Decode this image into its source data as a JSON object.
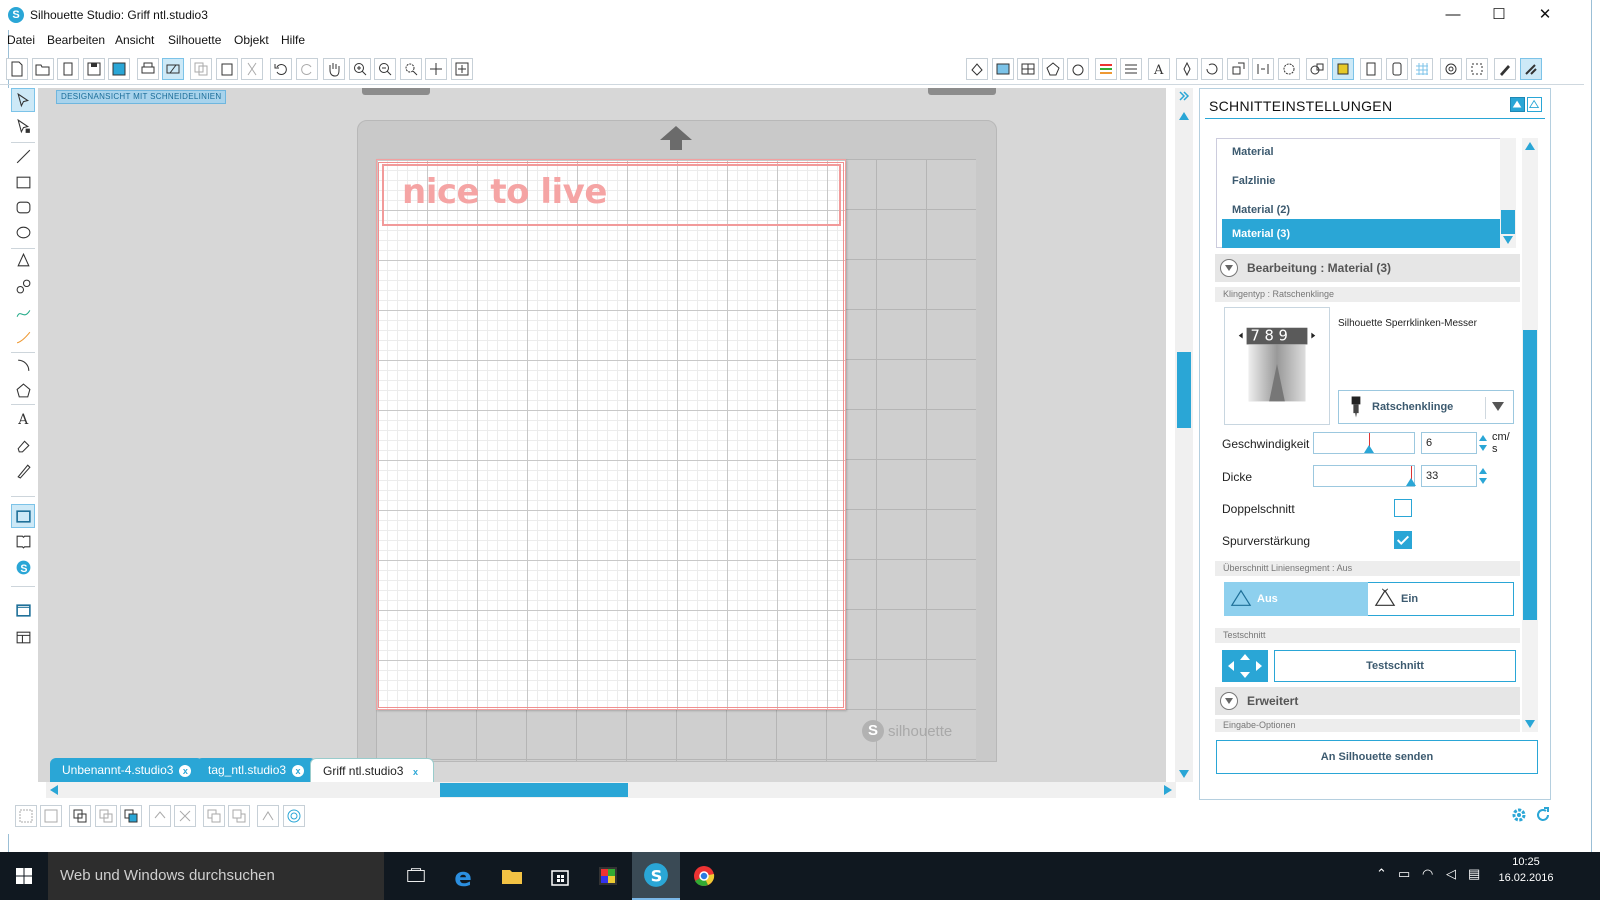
{
  "window": {
    "title": "Silhouette Studio: Griff ntl.studio3",
    "minimize": "—",
    "maximize": "☐",
    "close": "✕"
  },
  "menu": [
    "Datei",
    "Bearbeiten",
    "Ansicht",
    "Silhouette",
    "Objekt",
    "Hilfe"
  ],
  "canvas": {
    "view_label": "DESIGNANSICHT MIT SCHNEIDELINIEN",
    "design_text": "nice to live",
    "mat_brand": "silhouette"
  },
  "tabs": [
    {
      "label": "Unbenannt-4.studio3",
      "close": "x"
    },
    {
      "label": "tag_ntl.studio3",
      "close": "x"
    },
    {
      "label": "Griff ntl.studio3",
      "close": "x"
    }
  ],
  "panel": {
    "title": "SCHNITTEINSTELLUNGEN",
    "materials": [
      "Material",
      "Falzlinie",
      "Material (2)",
      "Material (3)"
    ],
    "list_add": "+",
    "list_remove": "—",
    "edit_section": "Bearbeitung : Material (3)",
    "blade_type_label": "Klingentyp : Ratschenklinge",
    "blade_name": "Silhouette Sperrklinken-Messer",
    "blade_dial": "7 8 9",
    "blade_select": "Ratschenklinge",
    "speed": {
      "label": "Geschwindigkeit",
      "value": "6",
      "unit": "cm/\ns",
      "level": 0.55
    },
    "thickness": {
      "label": "Dicke",
      "value": "33",
      "level": 0.97
    },
    "double_cut": {
      "label": "Doppelschnitt",
      "checked": false
    },
    "track_enhance": {
      "label": "Spurverstärkung",
      "checked": true
    },
    "overcut_label": "Überschnitt Liniensegment : Aus",
    "overcut_off": "Aus",
    "overcut_on": "Ein",
    "test_label": "Testschnitt",
    "test_button": "Testschnitt",
    "advanced": "Erweitert",
    "input_options": "Eingabe-Optionen",
    "send_button": "An Silhouette senden"
  },
  "taskbar": {
    "search_placeholder": "Web und Windows durchsuchen",
    "time": "10:25",
    "date": "16.02.2016"
  },
  "colors": {
    "accent": "#2aa6d6",
    "cut_line": "#f29a9a",
    "taskbar": "#101820"
  }
}
